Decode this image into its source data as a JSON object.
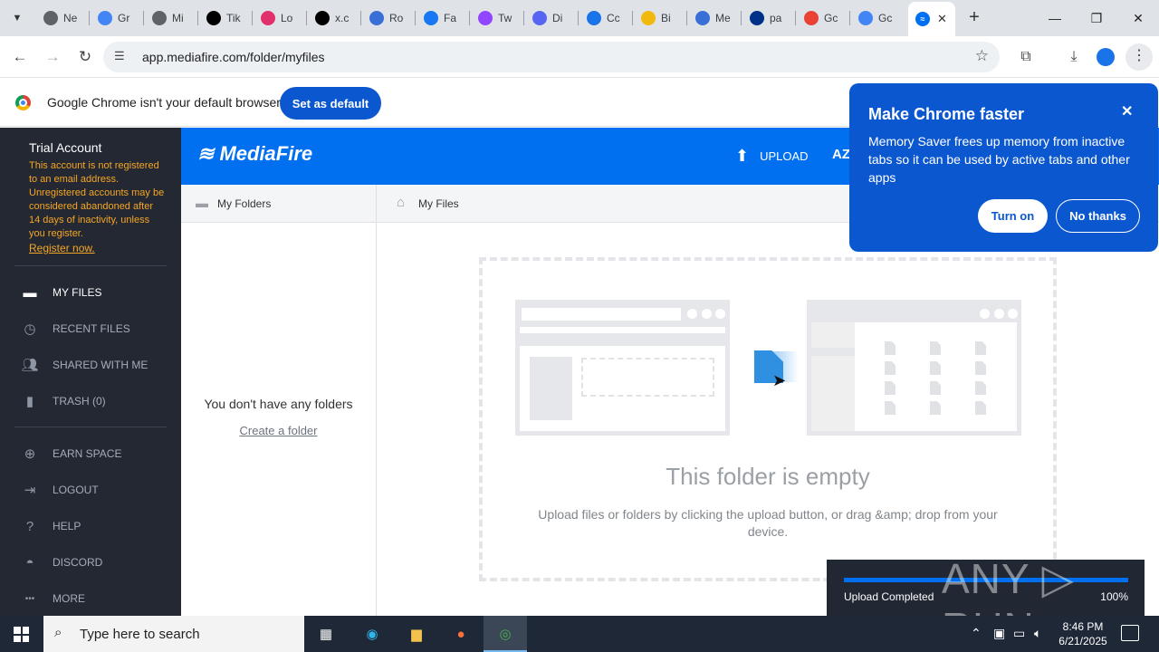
{
  "browser": {
    "tabs": [
      {
        "label": "Ne",
        "icon": "generic-tab-icon",
        "color": "#5f6368"
      },
      {
        "label": "Gr",
        "icon": "google-icon",
        "color": "#4285f4"
      },
      {
        "label": "Mi",
        "icon": "generic-tab-icon",
        "color": "#5f6368"
      },
      {
        "label": "Tik",
        "icon": "tiktok-icon",
        "color": "#000000"
      },
      {
        "label": "Lo",
        "icon": "instagram-icon",
        "color": "#e1306c"
      },
      {
        "label": "x.c",
        "icon": "x-icon",
        "color": "#000000"
      },
      {
        "label": "Ro",
        "icon": "roblox-icon",
        "color": "#3a6fd8"
      },
      {
        "label": "Fa",
        "icon": "facebook-icon",
        "color": "#1877f2"
      },
      {
        "label": "Tw",
        "icon": "twitch-icon",
        "color": "#9146ff"
      },
      {
        "label": "Di",
        "icon": "discord-icon",
        "color": "#5865f2"
      },
      {
        "label": "Cc",
        "icon": "ccleaner-icon",
        "color": "#1a73e8"
      },
      {
        "label": "Bi",
        "icon": "binance-icon",
        "color": "#f0b90b"
      },
      {
        "label": "Me",
        "icon": "generic-tab-icon",
        "color": "#3a6fd8"
      },
      {
        "label": "pa",
        "icon": "paypal-icon",
        "color": "#003087"
      },
      {
        "label": "Gc",
        "icon": "google-photos-icon",
        "color": "#ea4335"
      },
      {
        "label": "Gc",
        "icon": "google-icon",
        "color": "#4285f4"
      }
    ],
    "active_tab_close": "✕",
    "url": "app.mediafire.com/folder/myfiles"
  },
  "infobar": {
    "message": "Google Chrome isn't your default browser",
    "button": "Set as default"
  },
  "popup": {
    "title": "Make Chrome faster",
    "body": "Memory Saver frees up memory from inactive tabs so it can be used by active tabs and other apps",
    "turn_on": "Turn on",
    "no_thanks": "No thanks",
    "close": "✕"
  },
  "sidebar": {
    "account": "Trial Account",
    "warning": "This account is not registered to an email address. Unregistered accounts may be considered abandoned after 14 days of inactivity, unless you register.",
    "register": "Register now.",
    "items": [
      {
        "label": "MY FILES",
        "icon": "folder-icon"
      },
      {
        "label": "RECENT FILES",
        "icon": "clock-icon"
      },
      {
        "label": "SHARED WITH ME",
        "icon": "people-icon"
      },
      {
        "label": "TRASH (0)",
        "icon": "trash-icon"
      },
      {
        "label": "EARN SPACE",
        "icon": "plus-circle-icon"
      },
      {
        "label": "LOGOUT",
        "icon": "logout-icon"
      },
      {
        "label": "HELP",
        "icon": "help-icon"
      },
      {
        "label": "DISCORD",
        "icon": "discord-icon"
      },
      {
        "label": "MORE",
        "icon": "more-icon"
      }
    ]
  },
  "header": {
    "logo": "MediaFire",
    "upload": "UPLOAD",
    "sort": "AZ"
  },
  "breadcrumb": {
    "folders": "My Folders",
    "files": "My Files"
  },
  "folders_pane": {
    "empty": "You don't have any folders",
    "create": "Create a folder"
  },
  "main": {
    "empty_title": "This folder is empty",
    "empty_sub": "Upload files or folders by clicking the upload button, or drag &amp; drop from your device."
  },
  "upload_toast": {
    "status": "Upload Completed",
    "percent": "100%",
    "progress": 1.0
  },
  "watermark": "ANY ▷ RUN",
  "taskbar": {
    "search_placeholder": "Type here to search",
    "time": "8:46 PM",
    "date": "6/21/2025"
  },
  "colors": {
    "mediafire_blue": "#0070f0",
    "chrome_blue": "#0b57d0",
    "sidebar_bg": "#232833",
    "warning": "#f6a623"
  }
}
